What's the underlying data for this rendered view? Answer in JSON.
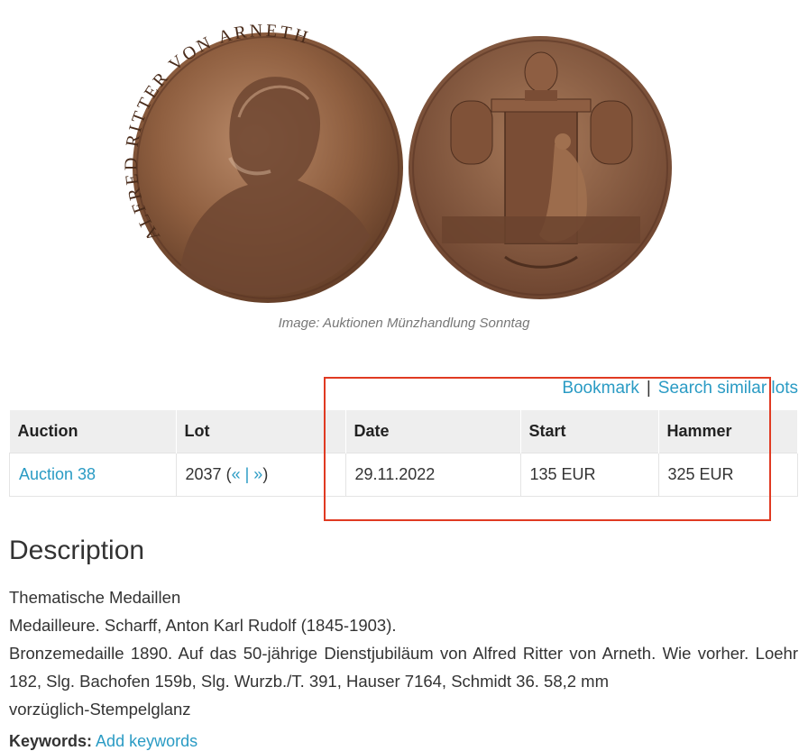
{
  "image": {
    "obverse_legend": "ALFRED RITTER VON ARNETH",
    "caption": "Image: Auktionen Münzhandlung Sonntag"
  },
  "actions": {
    "bookmark": "Bookmark",
    "separator": "|",
    "search_similar": "Search similar lots"
  },
  "table": {
    "headers": [
      "Auction",
      "Lot",
      "Date",
      "Start",
      "Hammer"
    ],
    "row": {
      "auction": "Auction 38",
      "lot_number": "2037",
      "lot_open": "(",
      "prev": "«",
      "nav_sep": "|",
      "next": "»",
      "lot_close": ")",
      "date": "29.11.2022",
      "start": "135 EUR",
      "hammer": "325 EUR"
    }
  },
  "description": {
    "title": "Description",
    "lines": [
      "Thematische Medaillen",
      "Medailleure. Scharff, Anton Karl Rudolf (1845-1903).",
      "Bronzemedaille 1890. Auf das 50-jährige Dienstjubiläum von Alfred Ritter von Arneth. Wie vorher. Loehr 182, Slg. Bachofen 159b, Slg. Wurzb./T. 391, Hauser 7164, Schmidt 36. 58,2 mm",
      "vorzüglich-Stempelglanz"
    ]
  },
  "keywords": {
    "label": "Keywords:",
    "link": "Add keywords"
  },
  "colors": {
    "link": "#2a9bc4",
    "highlight": "#e03a22",
    "bronze": "#8a5a3c",
    "header_bg": "#eeeeee"
  }
}
